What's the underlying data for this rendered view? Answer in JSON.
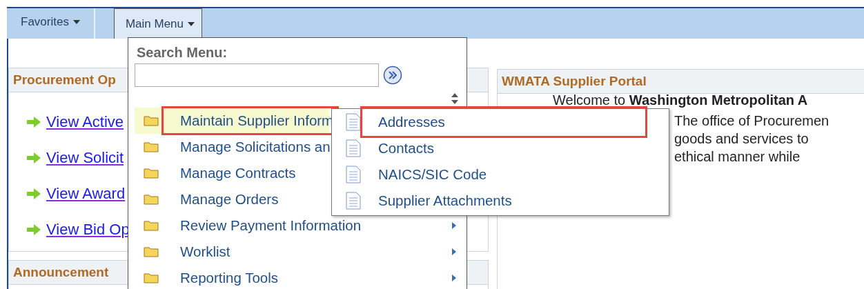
{
  "nav": [
    {
      "label": "Favorites",
      "selected": false
    },
    {
      "label": "Main Menu",
      "selected": true
    }
  ],
  "procurement_panel": {
    "title": "Procurement Op",
    "links": [
      "View Active",
      "View Solicit",
      "View Award",
      "View Bid Op"
    ]
  },
  "announcement_panel": {
    "title": "Announcement"
  },
  "portal": {
    "title": "WMATA Supplier Portal",
    "lines": [
      "Welcome to **Washington Metropolitan A**",
      "The office of Procuremen",
      "goods and services to",
      "ethical manner while"
    ]
  },
  "main_menu": {
    "search_label": "Search Menu:",
    "items": [
      {
        "label": "Maintain Supplier Inform",
        "highlighted": true,
        "arrow": false
      },
      {
        "label": "Manage Solicitations an",
        "highlighted": false,
        "arrow": false
      },
      {
        "label": "Manage Contracts",
        "highlighted": false,
        "arrow": false
      },
      {
        "label": "Manage Orders",
        "highlighted": false,
        "arrow": false
      },
      {
        "label": "Review Payment Information",
        "highlighted": false,
        "arrow": true
      },
      {
        "label": "Worklist",
        "highlighted": false,
        "arrow": true
      },
      {
        "label": "Reporting Tools",
        "highlighted": false,
        "arrow": true
      }
    ]
  },
  "submenu": {
    "items": [
      {
        "label": "Addresses",
        "highlighted": true
      },
      {
        "label": "Contacts",
        "highlighted": false
      },
      {
        "label": "NAICS/SIC Code",
        "highlighted": false
      },
      {
        "label": "Supplier Attachments",
        "highlighted": false
      }
    ]
  }
}
